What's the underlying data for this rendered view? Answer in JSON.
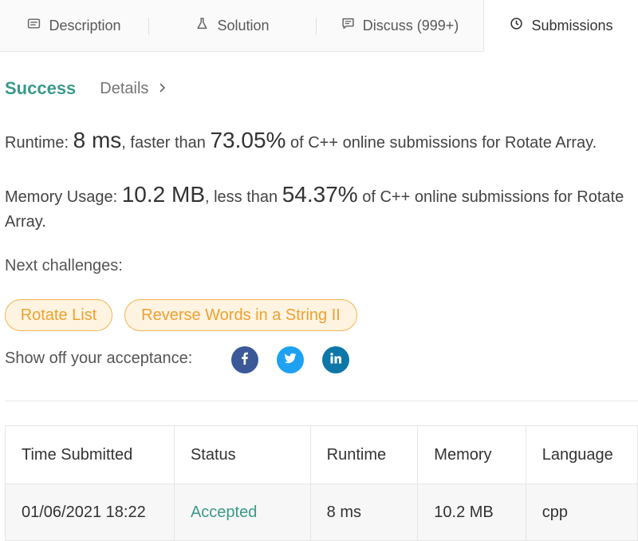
{
  "tabs": [
    {
      "label": "Description",
      "icon": "description-icon"
    },
    {
      "label": "Solution",
      "icon": "flask-icon"
    },
    {
      "label": "Discuss (999+)",
      "icon": "comment-icon"
    },
    {
      "label": "Submissions",
      "icon": "clock-icon"
    }
  ],
  "result": {
    "status": "Success",
    "details_label": "Details"
  },
  "runtime": {
    "prefix": "Runtime: ",
    "value": "8 ms",
    "middle": ", faster than ",
    "percent": "73.05%",
    "suffix": " of C++ online submissions for Rotate Array."
  },
  "memory": {
    "prefix": "Memory Usage: ",
    "value": "10.2 MB",
    "middle": ", less than ",
    "percent": "54.37%",
    "suffix": " of C++ online submissions for Rotate Array."
  },
  "next_challenges": {
    "label": "Next challenges:",
    "items": [
      "Rotate List",
      "Reverse Words in a String II"
    ]
  },
  "share": {
    "label": "Show off your acceptance:",
    "networks": [
      "facebook",
      "twitter",
      "linkedin"
    ]
  },
  "table": {
    "headers": [
      "Time Submitted",
      "Status",
      "Runtime",
      "Memory",
      "Language"
    ],
    "rows": [
      [
        "01/06/2021 18:22",
        "Accepted",
        "8 ms",
        "10.2 MB",
        "cpp"
      ]
    ]
  },
  "colors": {
    "success": "#3a9a8a",
    "chip_border": "#f3b24e",
    "chip_bg": "#fff4e1",
    "chip_text": "#f0a030",
    "facebook": "#3b5998",
    "twitter": "#1da1f2",
    "linkedin": "#0e76a8"
  }
}
